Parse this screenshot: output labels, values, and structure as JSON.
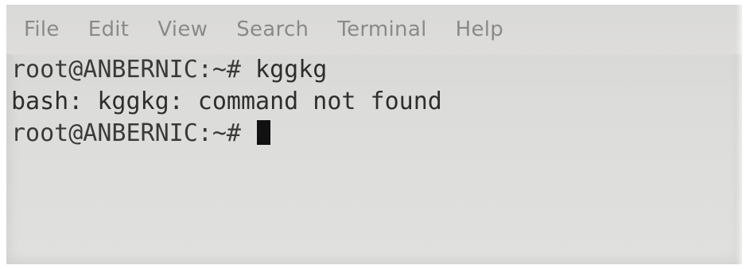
{
  "menubar": {
    "items": [
      {
        "label": "File"
      },
      {
        "label": "Edit"
      },
      {
        "label": "View"
      },
      {
        "label": "Search"
      },
      {
        "label": "Terminal"
      },
      {
        "label": "Help"
      }
    ]
  },
  "terminal": {
    "lines": [
      {
        "prompt": "root@ANBERNIC:~#",
        "command": "kggkg"
      },
      {
        "output": "bash: kggkg: command not found"
      },
      {
        "prompt": "root@ANBERNIC:~#",
        "command": ""
      }
    ]
  },
  "colors": {
    "background": "#dcdcda",
    "text": "#2e2e2e",
    "menu_text": "#8a8a88",
    "cursor": "#111111"
  }
}
